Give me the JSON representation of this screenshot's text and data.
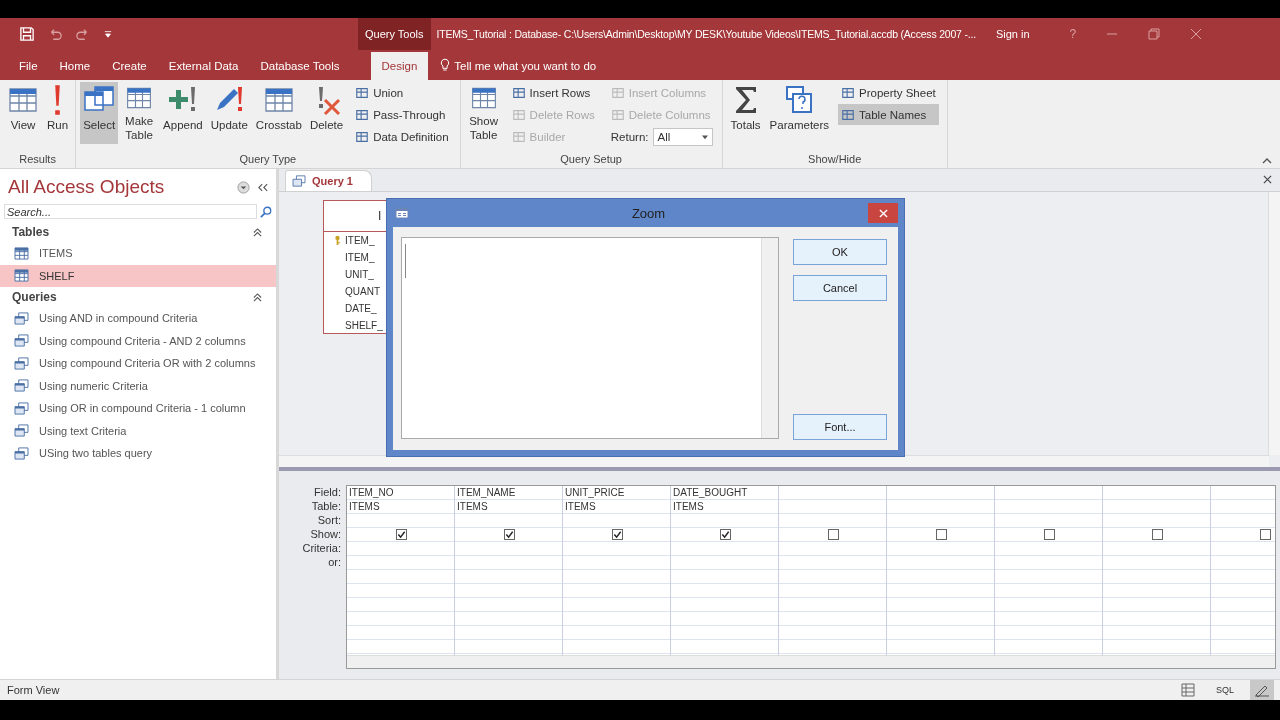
{
  "title_bar": {
    "context_label": "Query Tools",
    "title": "ITEMS_Tutorial : Database- C:\\Users\\Admin\\Desktop\\MY DESK\\Youtube Videos\\ITEMS_Tutorial.accdb (Access 2007 -...",
    "sign_in": "Sign in",
    "help": "?"
  },
  "ribbon_tabs": [
    {
      "label": "File",
      "selected": false
    },
    {
      "label": "Home",
      "selected": false
    },
    {
      "label": "Create",
      "selected": false
    },
    {
      "label": "External Data",
      "selected": false
    },
    {
      "label": "Database Tools",
      "selected": false
    },
    {
      "label": "Design",
      "selected": true
    }
  ],
  "tell_me": "Tell me what you want to do",
  "ribbon_groups": [
    {
      "label": "Results",
      "items": [
        {
          "kind": "large",
          "label": "View",
          "pressed": false,
          "disabled": false
        },
        {
          "kind": "large",
          "label": "Run",
          "pressed": false,
          "disabled": false
        }
      ]
    },
    {
      "label": "Query Type",
      "items": [
        {
          "kind": "large",
          "label": "Select",
          "pressed": true,
          "disabled": false
        },
        {
          "kind": "large",
          "label": "Make Table",
          "pressed": false,
          "disabled": false
        },
        {
          "kind": "large",
          "label": "Append",
          "pressed": false,
          "disabled": false
        },
        {
          "kind": "large",
          "label": "Update",
          "pressed": false,
          "disabled": false
        },
        {
          "kind": "large",
          "label": "Crosstab",
          "pressed": false,
          "disabled": false
        },
        {
          "kind": "large",
          "label": "Delete",
          "pressed": false,
          "disabled": false
        },
        {
          "kind": "column",
          "items": [
            {
              "kind": "small",
              "label": "Union",
              "pressed": false,
              "disabled": false
            },
            {
              "kind": "small",
              "label": "Pass-Through",
              "pressed": false,
              "disabled": false
            },
            {
              "kind": "small",
              "label": "Data Definition",
              "pressed": false,
              "disabled": false
            }
          ]
        }
      ]
    },
    {
      "label": "Query Setup",
      "items": [
        {
          "kind": "large",
          "label": "Show Table",
          "pressed": false,
          "disabled": false
        },
        {
          "kind": "column",
          "items": [
            {
              "kind": "small",
              "label": "Insert Rows",
              "pressed": false,
              "disabled": false
            },
            {
              "kind": "small",
              "label": "Delete Rows",
              "pressed": false,
              "disabled": true
            },
            {
              "kind": "small",
              "label": "Builder",
              "pressed": false,
              "disabled": true
            }
          ]
        },
        {
          "kind": "column",
          "items": [
            {
              "kind": "small",
              "label": "Insert Columns",
              "pressed": false,
              "disabled": true
            },
            {
              "kind": "small",
              "label": "Delete Columns",
              "pressed": false,
              "disabled": true
            },
            {
              "kind": "combo",
              "label": "Return:",
              "value": "All"
            }
          ]
        }
      ]
    },
    {
      "label": "Show/Hide",
      "items": [
        {
          "kind": "large",
          "label": "Totals",
          "pressed": false,
          "disabled": false
        },
        {
          "kind": "large",
          "label": "Parameters",
          "pressed": false,
          "disabled": false
        },
        {
          "kind": "column",
          "items": [
            {
              "kind": "small",
              "label": "Property Sheet",
              "pressed": false,
              "disabled": false
            },
            {
              "kind": "small",
              "label": "Table Names",
              "pressed": true,
              "disabled": false
            }
          ]
        }
      ]
    }
  ],
  "nav_pane": {
    "title": "All Access Objects",
    "search": {
      "placeholder": "Search..."
    },
    "groups": [
      {
        "label": "Tables",
        "kind": "table",
        "items": [
          {
            "label": "ITEMS",
            "selected": false
          },
          {
            "label": "SHELF",
            "selected": true
          }
        ]
      },
      {
        "label": "Queries",
        "kind": "query",
        "items": [
          {
            "label": "Using AND in compound Criteria",
            "selected": false
          },
          {
            "label": "Using compound Criteria - AND 2 columns",
            "selected": false
          },
          {
            "label": "Using compound Criteria OR with 2 columns",
            "selected": false
          },
          {
            "label": "Using numeric Criteria",
            "selected": false
          },
          {
            "label": "Using OR in compound Criteria - 1 column",
            "selected": false
          },
          {
            "label": "Using text Criteria",
            "selected": false
          },
          {
            "label": "USing two tables query",
            "selected": false
          }
        ]
      }
    ]
  },
  "document_tabs": [
    {
      "label": "Query 1",
      "selected": true
    }
  ],
  "table_box": {
    "title": "I",
    "fields": [
      {
        "name": "ITEM_",
        "primary_key": true
      },
      {
        "name": "ITEM_",
        "primary_key": false
      },
      {
        "name": "UNIT_",
        "primary_key": false
      },
      {
        "name": "QUANT",
        "primary_key": false
      },
      {
        "name": "DATE_",
        "primary_key": false
      },
      {
        "name": "SHELF_",
        "primary_key": false
      }
    ]
  },
  "zoom_dialog": {
    "title": "Zoom",
    "buttons": [
      "OK",
      "Cancel",
      "Font..."
    ]
  },
  "design_grid": {
    "row_labels": [
      "Field:",
      "Table:",
      "Sort:",
      "Show:",
      "Criteria:",
      "or:"
    ],
    "columns": [
      {
        "field": "ITEM_NO",
        "table": "ITEMS",
        "show": true
      },
      {
        "field": "ITEM_NAME",
        "table": "ITEMS",
        "show": true
      },
      {
        "field": "UNIT_PRICE",
        "table": "ITEMS",
        "show": true
      },
      {
        "field": "DATE_BOUGHT",
        "table": "ITEMS",
        "show": true
      },
      {
        "show": false
      },
      {
        "show": false
      },
      {
        "show": false
      },
      {
        "show": false
      },
      {
        "show": false
      }
    ]
  },
  "status_bar": {
    "text": "Form View",
    "views": [
      {
        "kind": "datasheet",
        "selected": false
      },
      {
        "kind": "sql",
        "label": "SQL",
        "selected": false
      },
      {
        "kind": "design",
        "selected": true
      }
    ]
  }
}
